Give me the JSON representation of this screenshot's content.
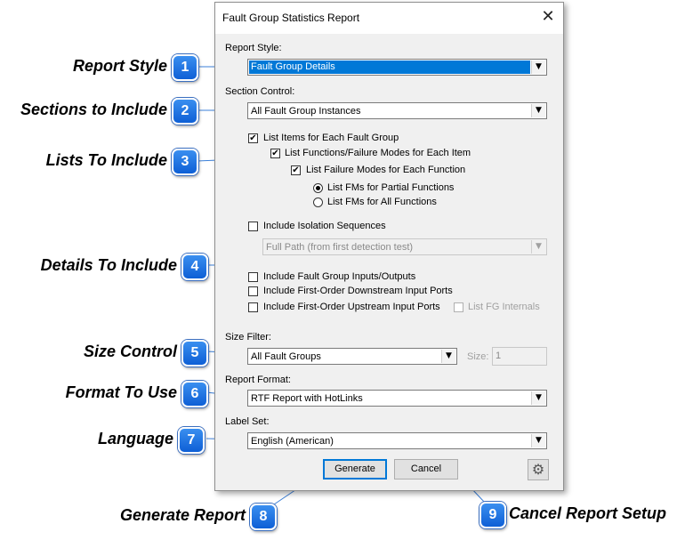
{
  "dialog": {
    "title": "Fault Group Statistics Report",
    "close_glyph": "✕",
    "report_style": {
      "label": "Report Style:",
      "value": "Fault Group Details"
    },
    "section_control": {
      "label": "Section Control:",
      "value": "All Fault Group Instances"
    },
    "lists": {
      "list_items": {
        "label": "List Items for Each Fault Group",
        "checked": true
      },
      "list_functions": {
        "label": "List Functions/Failure Modes for Each Item",
        "checked": true
      },
      "list_failure_modes": {
        "label": "List Failure Modes for Each Function",
        "checked": true
      },
      "radio_partial": {
        "label": "List FMs for Partial Functions",
        "selected": true
      },
      "radio_all": {
        "label": "List FMs for All Functions",
        "selected": false
      }
    },
    "details": {
      "isolation": {
        "label": "Include Isolation Sequences",
        "checked": false
      },
      "isolation_combo": {
        "value": "Full Path (from first detection test)"
      },
      "inputs_outputs": {
        "label": "Include Fault Group Inputs/Outputs",
        "checked": false
      },
      "downstream": {
        "label": "Include First-Order Downstream Input Ports",
        "checked": false
      },
      "upstream": {
        "label": "Include First-Order Upstream Input Ports",
        "checked": false
      },
      "fg_internals": {
        "label": "List FG Internals",
        "checked": false
      }
    },
    "size_filter": {
      "label": "Size Filter:",
      "value": "All Fault Groups",
      "size_label": "Size:",
      "size_value": "1"
    },
    "report_format": {
      "label": "Report Format:",
      "value": "RTF Report with HotLinks"
    },
    "label_set": {
      "label": "Label Set:",
      "value": "English (American)"
    },
    "buttons": {
      "generate": "Generate",
      "cancel": "Cancel"
    },
    "dropdown_glyph": "▼",
    "check_glyph": "✔",
    "gear_glyph": "⚙"
  },
  "callouts": [
    {
      "num": "1",
      "label": "Report Style"
    },
    {
      "num": "2",
      "label": "Sections to Include"
    },
    {
      "num": "3",
      "label": "Lists To Include"
    },
    {
      "num": "4",
      "label": "Details To Include"
    },
    {
      "num": "5",
      "label": "Size Control"
    },
    {
      "num": "6",
      "label": "Format To Use"
    },
    {
      "num": "7",
      "label": "Language"
    },
    {
      "num": "8",
      "label": "Generate Report"
    },
    {
      "num": "9",
      "label": "Cancel Report Setup"
    }
  ],
  "colors": {
    "accent": "#0078d7",
    "badge": "#1a6fe0"
  }
}
